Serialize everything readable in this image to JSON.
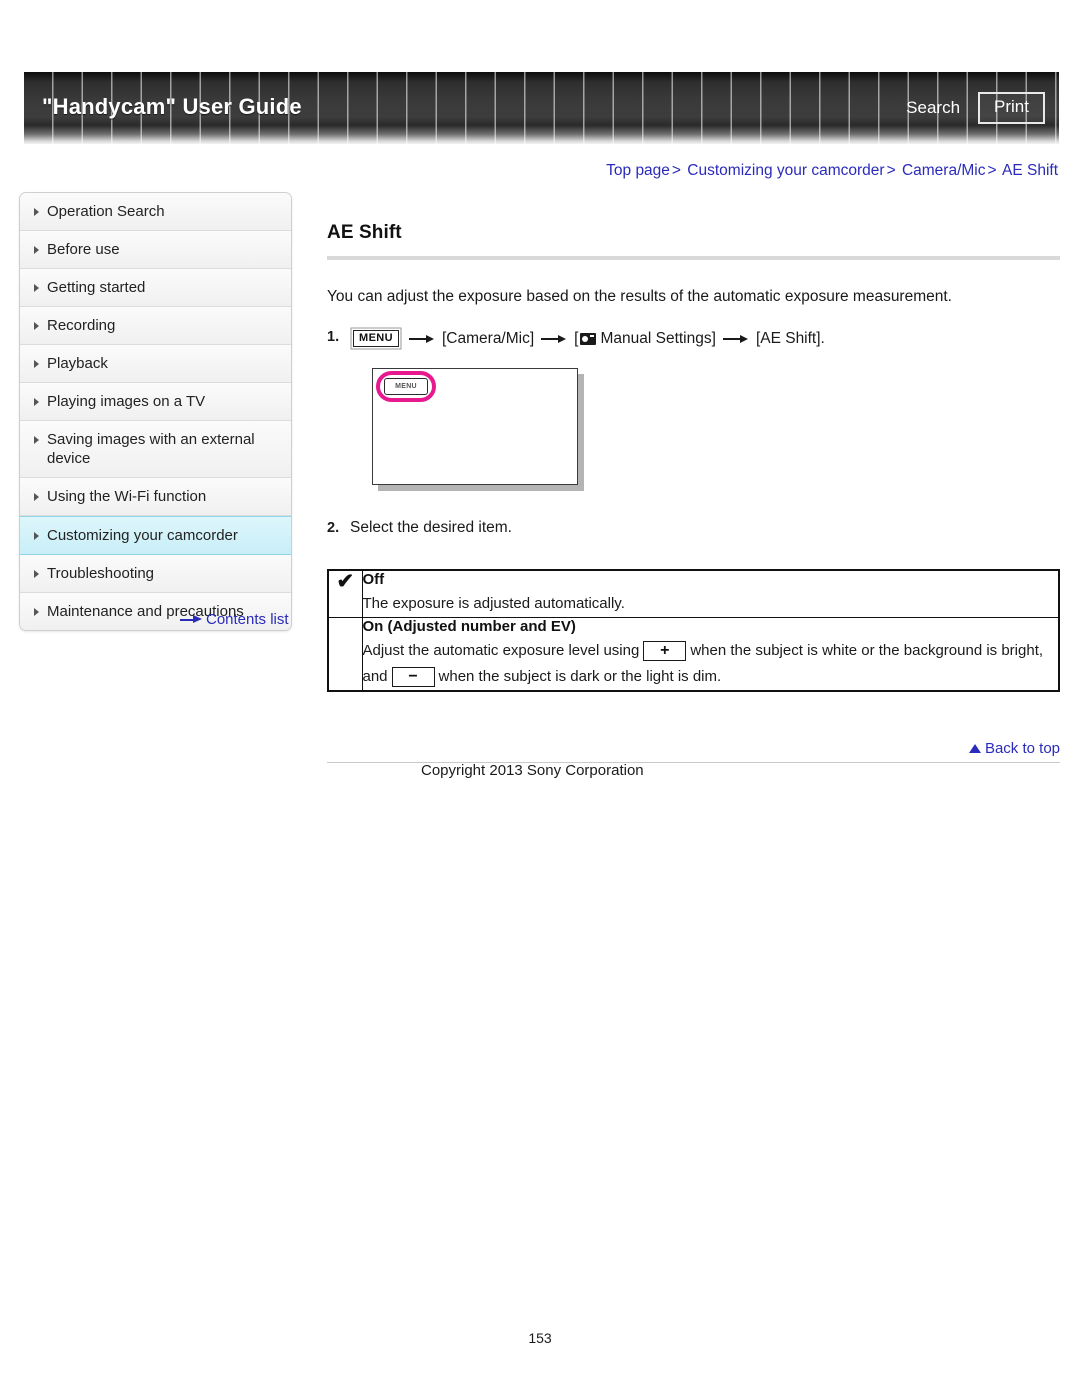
{
  "header": {
    "title": "\"Handycam\" User Guide",
    "search_label": "Search",
    "print_label": "Print"
  },
  "breadcrumb": {
    "items": [
      {
        "label": "Top page"
      },
      {
        "label": "Customizing your camcorder"
      },
      {
        "label": "Camera/Mic"
      },
      {
        "label": "AE Shift"
      }
    ],
    "separator": ">",
    "link_color": "#2b2bbb"
  },
  "sidebar": {
    "items": [
      {
        "label": "Operation Search",
        "active": false
      },
      {
        "label": "Before use",
        "active": false
      },
      {
        "label": "Getting started",
        "active": false
      },
      {
        "label": "Recording",
        "active": false
      },
      {
        "label": "Playback",
        "active": false
      },
      {
        "label": "Playing images on a TV",
        "active": false
      },
      {
        "label": "Saving images with an external device",
        "active": false
      },
      {
        "label": "Using the Wi-Fi function",
        "active": false
      },
      {
        "label": "Customizing your camcorder",
        "active": true
      },
      {
        "label": "Troubleshooting",
        "active": false
      },
      {
        "label": "Maintenance and precautions",
        "active": false
      }
    ],
    "active_highlight_color": "#c9eef7",
    "contents_link": "Contents list"
  },
  "main": {
    "page_title": "AE Shift",
    "intro": "You can adjust the exposure based on the results of the automatic exposure measurement.",
    "step1": {
      "number": "1.",
      "menu_chip": "MENU",
      "part1": "[Camera/Mic]",
      "part2_prefix": "[",
      "part2": "Manual Settings]",
      "part3": "[AE Shift]."
    },
    "lcd": {
      "menu_button_label": "MENU",
      "highlight_color": "#e8188f"
    },
    "step2": {
      "number": "2.",
      "text": "Select the desired item."
    },
    "options": [
      {
        "checked": true,
        "check_glyph": "✔",
        "title": "Off",
        "description": "The exposure is adjusted automatically."
      },
      {
        "checked": false,
        "check_glyph": "",
        "title": "On (Adjusted number and EV)",
        "desc_a": "Adjust the automatic exposure level using",
        "plus_chip": "+",
        "desc_b": "when the subject is white or the background is bright, and",
        "minus_chip": "−",
        "desc_c": "when the subject is dark or the light is dim."
      }
    ]
  },
  "footer": {
    "back_to_top": "Back to top",
    "copyright": "Copyright 2013 Sony Corporation",
    "page_number": "153"
  }
}
